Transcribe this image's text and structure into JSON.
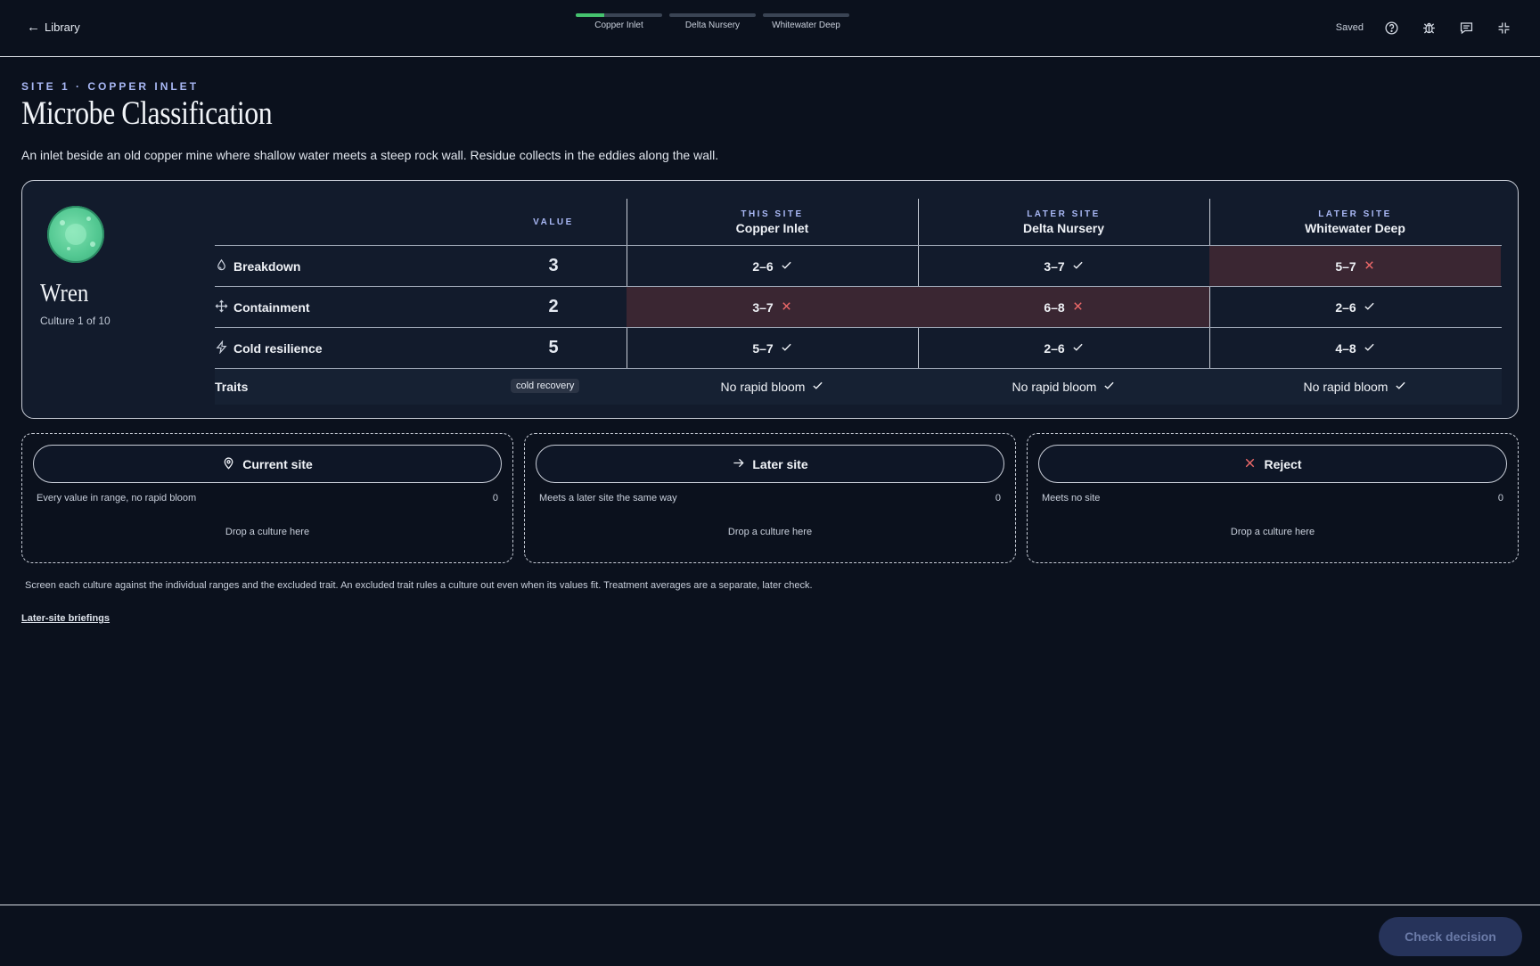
{
  "topbar": {
    "back_label": "Library",
    "steps": [
      {
        "label": "Copper Inlet",
        "progress": 0.33
      },
      {
        "label": "Delta Nursery",
        "progress": 0
      },
      {
        "label": "Whitewater Deep",
        "progress": 0
      }
    ],
    "saved_label": "Saved",
    "icons": [
      "help-icon",
      "bug-icon",
      "comment-icon",
      "minimize-icon"
    ]
  },
  "header": {
    "eyebrow": "SITE 1 · COPPER INLET",
    "title": "Microbe Classification",
    "description": "An inlet beside an old copper mine where shallow water meets a steep rock wall. Residue collects in the eddies along the wall."
  },
  "culture": {
    "name": "Wren",
    "subtitle": "Culture 1 of 10"
  },
  "table": {
    "value_header": "VALUE",
    "columns": [
      {
        "kicker": "THIS SITE",
        "name": "Copper Inlet"
      },
      {
        "kicker": "LATER SITE",
        "name": "Delta Nursery"
      },
      {
        "kicker": "LATER SITE",
        "name": "Whitewater Deep"
      }
    ],
    "rows": [
      {
        "label": "Breakdown",
        "icon": "droplet-icon",
        "value": "3",
        "cells": [
          {
            "range": "2–6",
            "ok": true
          },
          {
            "range": "3–7",
            "ok": true
          },
          {
            "range": "5–7",
            "ok": false
          }
        ]
      },
      {
        "label": "Containment",
        "icon": "move-icon",
        "value": "2",
        "cells": [
          {
            "range": "3–7",
            "ok": false
          },
          {
            "range": "6–8",
            "ok": false
          },
          {
            "range": "2–6",
            "ok": true
          }
        ]
      },
      {
        "label": "Cold resilience",
        "icon": "bolt-icon",
        "value": "5",
        "cells": [
          {
            "range": "5–7",
            "ok": true
          },
          {
            "range": "2–6",
            "ok": true
          },
          {
            "range": "4–8",
            "ok": true
          }
        ]
      }
    ],
    "traits": {
      "label": "Traits",
      "chip": "cold recovery",
      "cells": [
        {
          "text": "No rapid bloom",
          "ok": true
        },
        {
          "text": "No rapid bloom",
          "ok": true
        },
        {
          "text": "No rapid bloom",
          "ok": true
        }
      ]
    }
  },
  "bins": [
    {
      "label": "Current site",
      "icon": "pin-icon",
      "desc": "Every value in range, no rapid bloom",
      "count": "0",
      "drop": "Drop a culture here"
    },
    {
      "label": "Later site",
      "icon": "arrow-right-icon",
      "desc": "Meets a later site the same way",
      "count": "0",
      "drop": "Drop a culture here"
    },
    {
      "label": "Reject",
      "icon": "x-icon",
      "desc": "Meets no site",
      "count": "0",
      "drop": "Drop a culture here"
    }
  ],
  "footnote": "Screen each culture against the individual ranges and the excluded trait. An excluded trait rules a culture out even when its values fit. Treatment averages are a separate, later check.",
  "briefings_link": "Later-site briefings",
  "check_button": "Check decision",
  "colors": {
    "background": "#0b111d",
    "accent": "#a9b8f5",
    "progress": "#45c26e",
    "reject": "#f06a6a",
    "bad_cell": "#3a2632"
  }
}
